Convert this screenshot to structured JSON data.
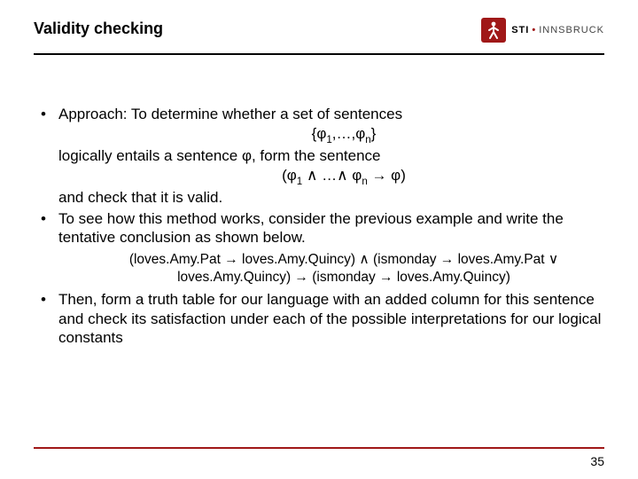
{
  "header": {
    "title": "Validity checking",
    "logo_brand": "STI",
    "logo_sep": "•",
    "logo_location": "INNSBRUCK"
  },
  "bullets": {
    "b1_line1": "Approach: To determine whether a set of sentences",
    "b1_set_open": "{φ",
    "b1_set_sub1": "1",
    "b1_set_mid": ",…,φ",
    "b1_set_subn": "n",
    "b1_set_close": "}",
    "b1_line2a": "logically entails a sentence φ, form the sentence",
    "b1_conj_open": "(φ",
    "b1_conj_sub1": "1",
    "b1_conj_mid": " ∧ …∧ φ",
    "b1_conj_subn": "n",
    "b1_conj_close": " → φ)",
    "b1_line3": "and check that it is valid.",
    "b2": "To see how this method works, consider the previous example and write the tentative conclusion as shown below.",
    "formula_l1": "(loves.Amy.Pat → loves.Amy.Quincy) ∧ (ismonday → loves.Amy.Pat ∨",
    "formula_l2": "loves.Amy.Quincy) → (ismonday → loves.Amy.Quincy)",
    "b3": "Then, form a truth table for our language with an added column for this sentence and check its satisfaction under each of the possible interpretations for our logical constants"
  },
  "footer": {
    "page": "35"
  }
}
